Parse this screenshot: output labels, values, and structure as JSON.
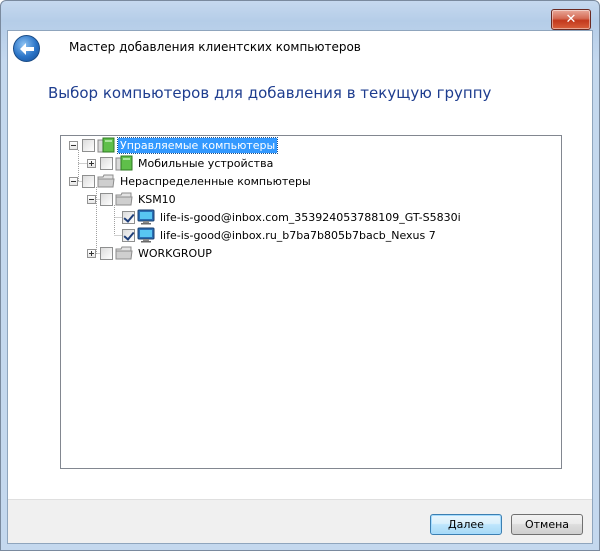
{
  "window": {
    "close_label": "✕"
  },
  "wizard": {
    "title": "Мастер добавления клиентских компьютеров",
    "heading": "Выбор компьютеров для добавления в текущую группу"
  },
  "tree": {
    "managed": "Управляемые компьютеры",
    "mobile": "Мобильные устройства",
    "unassigned": "Нераспределенные компьютеры",
    "ksm10": "KSM10",
    "device1": "life-is-good@inbox.com_353924053788109_GT-S5830i",
    "device2": "life-is-good@inbox.ru_b7ba7b805b7bacb_Nexus 7",
    "workgroup": "WORKGROUP"
  },
  "buttons": {
    "next": "Далее",
    "cancel": "Отмена"
  },
  "colors": {
    "heading": "#1e3d8f",
    "selection": "#3399ff"
  }
}
